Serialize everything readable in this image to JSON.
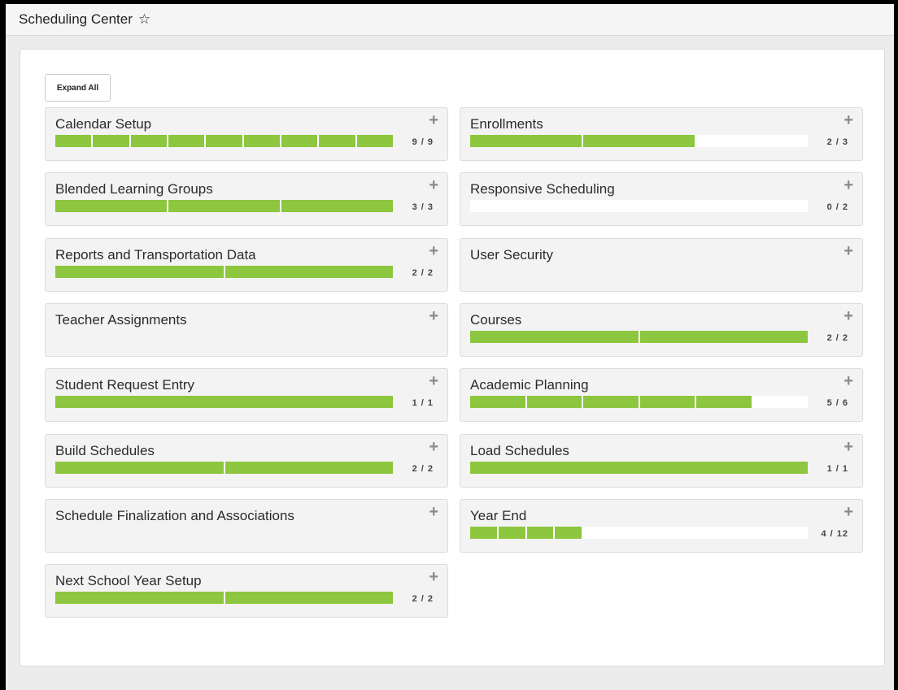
{
  "header": {
    "title": "Scheduling Center",
    "star_icon": "star-outline-icon"
  },
  "toolbar": {
    "expand_all_label": "Expand All"
  },
  "colors": {
    "progress_filled": "#8dc63f",
    "progress_empty": "#ffffff",
    "card_bg": "#f3f3f3"
  },
  "cards": [
    {
      "id": "calendar-setup",
      "title": "Calendar Setup",
      "done": 9,
      "total": 9,
      "progress_text": "9 / 9"
    },
    {
      "id": "enrollments",
      "title": "Enrollments",
      "done": 2,
      "total": 3,
      "progress_text": "2 / 3"
    },
    {
      "id": "blended-learning-groups",
      "title": "Blended Learning Groups",
      "done": 3,
      "total": 3,
      "progress_text": "3 / 3"
    },
    {
      "id": "responsive-scheduling",
      "title": "Responsive Scheduling",
      "done": 0,
      "total": 2,
      "progress_text": "0 / 2"
    },
    {
      "id": "reports-and-transportation-data",
      "title": "Reports and Transportation Data",
      "done": 2,
      "total": 2,
      "progress_text": "2 / 2"
    },
    {
      "id": "user-security",
      "title": "User Security",
      "done": null,
      "total": null,
      "progress_text": ""
    },
    {
      "id": "teacher-assignments",
      "title": "Teacher Assignments",
      "done": null,
      "total": null,
      "progress_text": ""
    },
    {
      "id": "courses",
      "title": "Courses",
      "done": 2,
      "total": 2,
      "progress_text": "2 / 2"
    },
    {
      "id": "student-request-entry",
      "title": "Student Request Entry",
      "done": 1,
      "total": 1,
      "progress_text": "1 / 1"
    },
    {
      "id": "academic-planning",
      "title": "Academic Planning",
      "done": 5,
      "total": 6,
      "progress_text": "5 / 6"
    },
    {
      "id": "build-schedules",
      "title": "Build Schedules",
      "done": 2,
      "total": 2,
      "progress_text": "2 / 2"
    },
    {
      "id": "load-schedules",
      "title": "Load Schedules",
      "done": 1,
      "total": 1,
      "progress_text": "1 / 1"
    },
    {
      "id": "schedule-finalization-and-associations",
      "title": "Schedule Finalization and Associations",
      "done": null,
      "total": null,
      "progress_text": ""
    },
    {
      "id": "year-end",
      "title": "Year End",
      "done": 4,
      "total": 12,
      "progress_text": "4 / 12"
    },
    {
      "id": "next-school-year-setup",
      "title": "Next School Year Setup",
      "done": 2,
      "total": 2,
      "progress_text": "2 / 2"
    }
  ]
}
